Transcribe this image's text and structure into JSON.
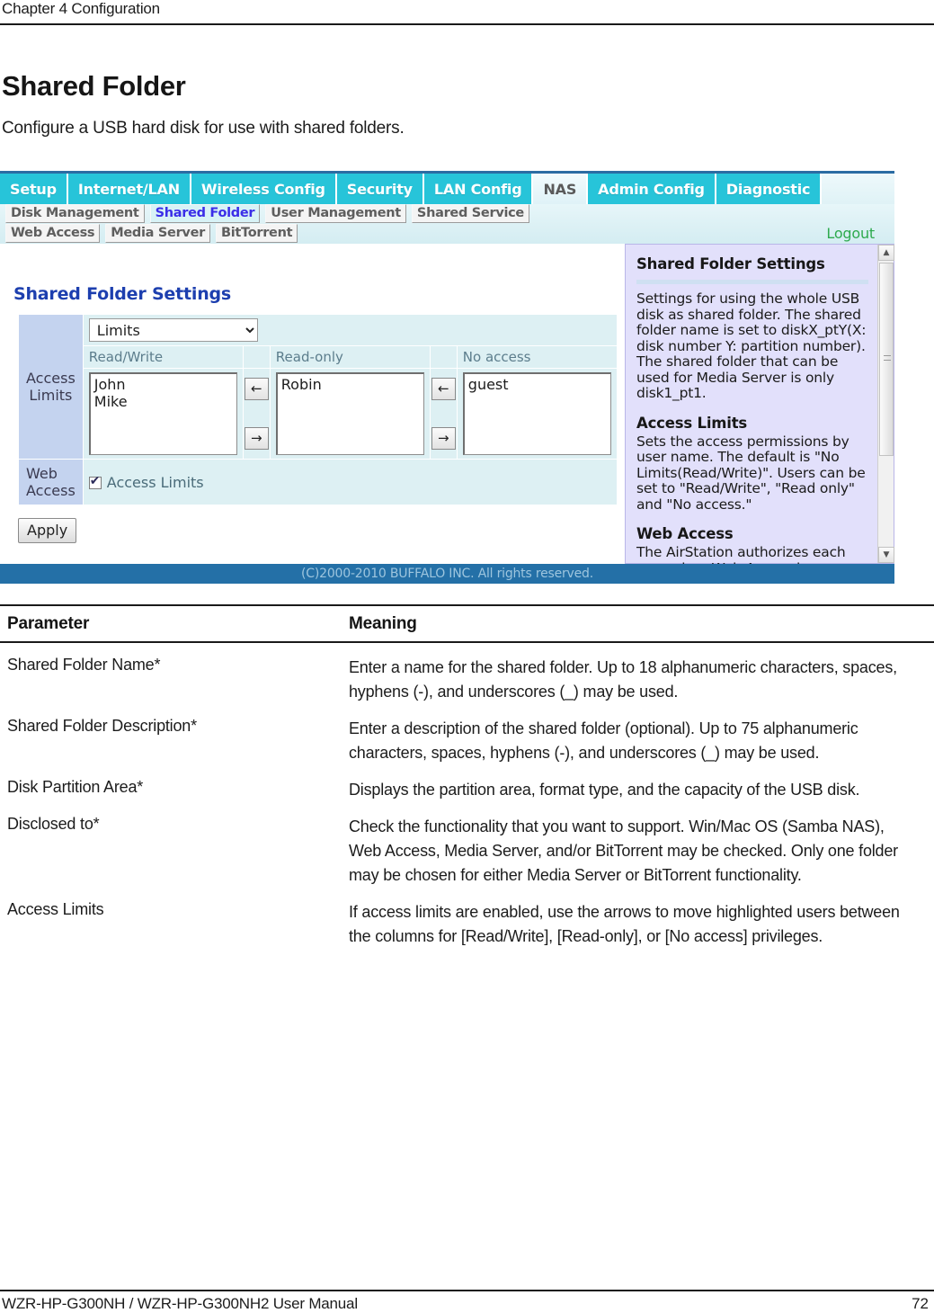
{
  "page": {
    "running_head": "Chapter 4  Configuration",
    "title": "Shared Folder",
    "subtitle": "Configure a USB hard disk for use with shared folders.",
    "footer_left": "WZR-HP-G300NH / WZR-HP-G300NH2 User Manual",
    "footer_page": "72"
  },
  "screenshot": {
    "main_tabs": [
      {
        "label": "Setup",
        "active": false
      },
      {
        "label": "Internet/LAN",
        "active": false
      },
      {
        "label": "Wireless Config",
        "active": false
      },
      {
        "label": "Security",
        "active": false
      },
      {
        "label": "LAN Config",
        "active": false
      },
      {
        "label": "NAS",
        "active": true
      },
      {
        "label": "Admin Config",
        "active": false
      },
      {
        "label": "Diagnostic",
        "active": false
      }
    ],
    "sub_tabs_row1": [
      {
        "label": "Disk Management",
        "selected": false
      },
      {
        "label": "Shared Folder",
        "selected": true
      },
      {
        "label": "User Management",
        "selected": false
      },
      {
        "label": "Shared Service",
        "selected": false
      }
    ],
    "sub_tabs_row2": [
      {
        "label": "Web Access",
        "selected": false
      },
      {
        "label": "Media Server",
        "selected": false
      },
      {
        "label": "BitTorrent",
        "selected": false
      }
    ],
    "logout_label": "Logout",
    "settings": {
      "heading": "Shared Folder Settings",
      "access_limits_label": "Access Limits",
      "limits_select_value": "Limits",
      "columns": {
        "read_write": "Read/Write",
        "read_only": "Read-only",
        "no_access": "No access"
      },
      "lists": {
        "read_write": "John\nMike",
        "read_only": "Robin",
        "no_access": "guest"
      },
      "arrow_left": "←",
      "arrow_right": "→",
      "web_access_label": "Web Access",
      "web_access_checkbox_label": "Access Limits",
      "apply_label": "Apply"
    },
    "help": {
      "h1": "Shared Folder Settings",
      "p1": "Settings for using the whole USB disk as shared folder. The shared folder name is set to diskX_ptY(X: disk number Y: partition number). The shared folder that can be used for Media Server is only disk1_pt1.",
      "h2": "Access Limits",
      "p2": "Sets the access permissions by user name. The default is \"No Limits(Read/Write)\". Users can be set to \"Read/Write\", \"Read only\" and \"No access.\"",
      "h3": "Web Access",
      "p3": "The AirStation authorizes each user when Web Access is"
    },
    "copyright": "(C)2000-2010 BUFFALO INC. All rights reserved."
  },
  "parameter_table": {
    "headers": {
      "parameter": "Parameter",
      "meaning": "Meaning"
    },
    "rows": [
      {
        "parameter": "Shared Folder Name*",
        "meaning": "Enter a name for the shared folder.  Up to 18 alphanumeric characters, spaces, hyphens (-), and underscores (_) may be used."
      },
      {
        "parameter": "Shared Folder Description*",
        "meaning": "Enter a description of the shared folder (optional).  Up to 75 alphanumeric characters, spaces, hyphens (-), and underscores (_) may be used."
      },
      {
        "parameter": "Disk Partition Area*",
        "meaning": "Displays the partition area, format type, and the capacity of the USB disk."
      },
      {
        "parameter": "Disclosed to*",
        "meaning": "Check the functionality that you want to support.  Win/Mac OS (Samba NAS), Web Access, Media Server, and/or BitTorrent may be checked.  Only one folder may be chosen for either Media Server or BitTorrent functionality."
      },
      {
        "parameter": "Access Limits",
        "meaning": "If access limits are enabled, use the arrows to move highlighted users between the columns for [Read/Write], [Read-only], or [No access] privileges."
      }
    ]
  },
  "colors": {
    "tab_cyan": "#27c4d9",
    "label_blue": "#c4d3ef",
    "field_blue": "#ddf0f3",
    "help_lavender": "#e2e0fb",
    "copyright_bar": "#2470a7",
    "heading_blue": "#1d3faf",
    "selected_tab_text": "#3b2ee8",
    "logout_green": "#2eaa4e"
  }
}
